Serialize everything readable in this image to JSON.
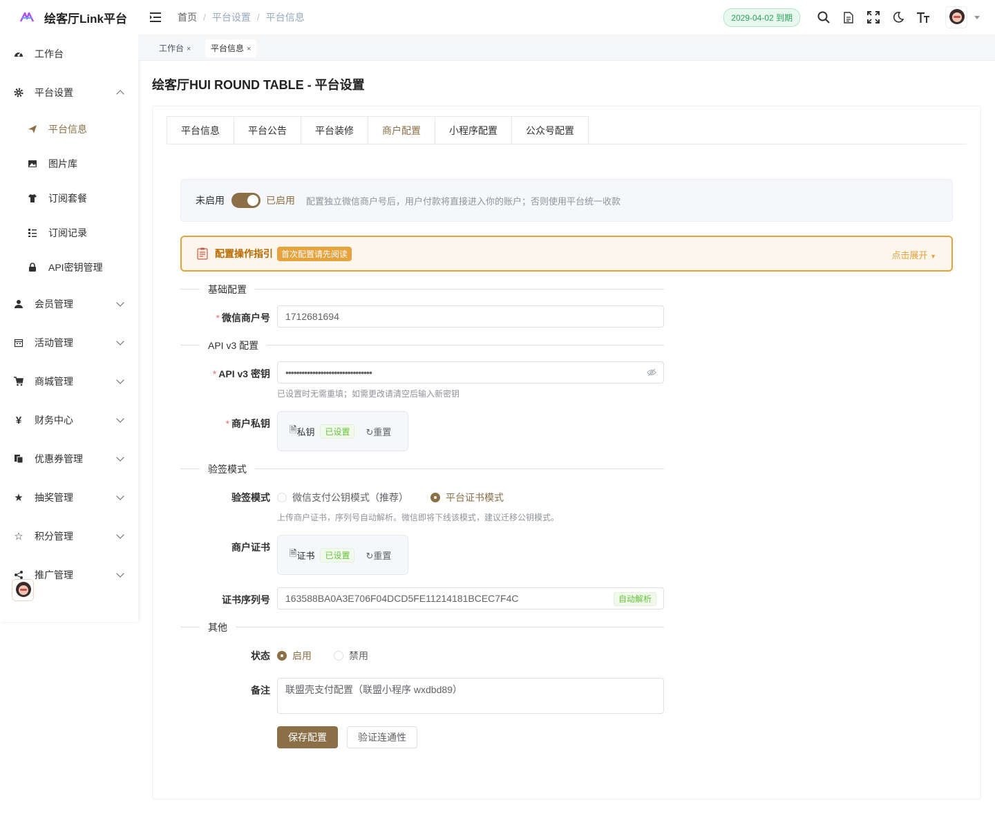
{
  "sidebar": {
    "app_title": "绘客厅Link平台",
    "items": [
      {
        "label": "工作台",
        "icon": "dashboard-icon"
      },
      {
        "label": "平台设置",
        "icon": "gear-icon"
      },
      {
        "label": "平台信息",
        "icon": "send-icon"
      },
      {
        "label": "图片库",
        "icon": "image-icon"
      },
      {
        "label": "订阅套餐",
        "icon": "shirt-icon"
      },
      {
        "label": "订阅记录",
        "icon": "list-icon"
      },
      {
        "label": "API密钥管理",
        "icon": "lock-icon"
      },
      {
        "label": "会员管理",
        "icon": "user-icon"
      },
      {
        "label": "活动管理",
        "icon": "calendar-icon"
      },
      {
        "label": "商城管理",
        "icon": "cart-icon"
      },
      {
        "label": "财务中心",
        "icon": "yen-icon"
      },
      {
        "label": "优惠券管理",
        "icon": "coupon-icon"
      },
      {
        "label": "抽奖管理",
        "icon": "star-icon"
      },
      {
        "label": "积分管理",
        "icon": "star-outline-icon"
      },
      {
        "label": "推广管理",
        "icon": "share-icon"
      }
    ]
  },
  "navbar": {
    "breadcrumb": [
      "首页",
      "平台设置",
      "平台信息"
    ],
    "breadcrumb_sep": "/",
    "expire_badge": "2029-04-02 到期"
  },
  "tags": [
    {
      "label": "工作台",
      "close": "×"
    },
    {
      "label": "平台信息",
      "close": "×"
    }
  ],
  "page_title": "绘客厅HUI ROUND TABLE - 平台设置",
  "tabs": [
    "平台信息",
    "平台公告",
    "平台装修",
    "商户配置",
    "小程序配置",
    "公众号配置"
  ],
  "active_tab": "商户配置",
  "switch": {
    "off_label": "未启用",
    "on_label": "已启用",
    "enabled": true,
    "tip": "配置独立微信商户号后，用户付款将直接进入你的账户；否则使用平台统一收款"
  },
  "guide": {
    "title": "配置操作指引",
    "badge": "首次配置请先阅读",
    "expand": "点击展开"
  },
  "sections": {
    "basic": "基础配置",
    "api": "API v3 配置",
    "verify": "验签模式",
    "other": "其他"
  },
  "form": {
    "mch_id_label": "微信商户号",
    "mch_id": "1712681694",
    "api_key_label": "API v3 密钥",
    "api_key_masked": "••••••••••••••••••••••••••••••••",
    "api_key_hint": "已设置时无需重填；如需更改请清空后输入新密钥",
    "private_key_label": "商户私钥",
    "private_key_file": "私钥",
    "private_key_status": "已设置",
    "reset": "重置",
    "verify_mode_label": "验签模式",
    "verify_options": [
      "微信支付公钥模式（推荐）",
      "平台证书模式"
    ],
    "verify_selected": "平台证书模式",
    "verify_hint": "上传商户证书，序列号自动解析。微信即将下线该模式，建议迁移公钥模式。",
    "cert_label": "商户证书",
    "cert_file": "证书",
    "cert_status": "已设置",
    "serial_label": "证书序列号",
    "serial": "163588BA0A3E706F04DCD5FE11214181BCEC7F4C",
    "serial_badge": "自动解析",
    "status_label": "状态",
    "status_options": [
      "启用",
      "禁用"
    ],
    "status_selected": "启用",
    "remark_label": "备注",
    "remark": "联盟壳支付配置（联盟小程序 wxdbd89）",
    "save_button": "保存配置",
    "test_button": "验证连通性"
  },
  "colors": {
    "accent": "#8b6f47",
    "warning": "#e6a23c",
    "success": "#67c23a"
  }
}
